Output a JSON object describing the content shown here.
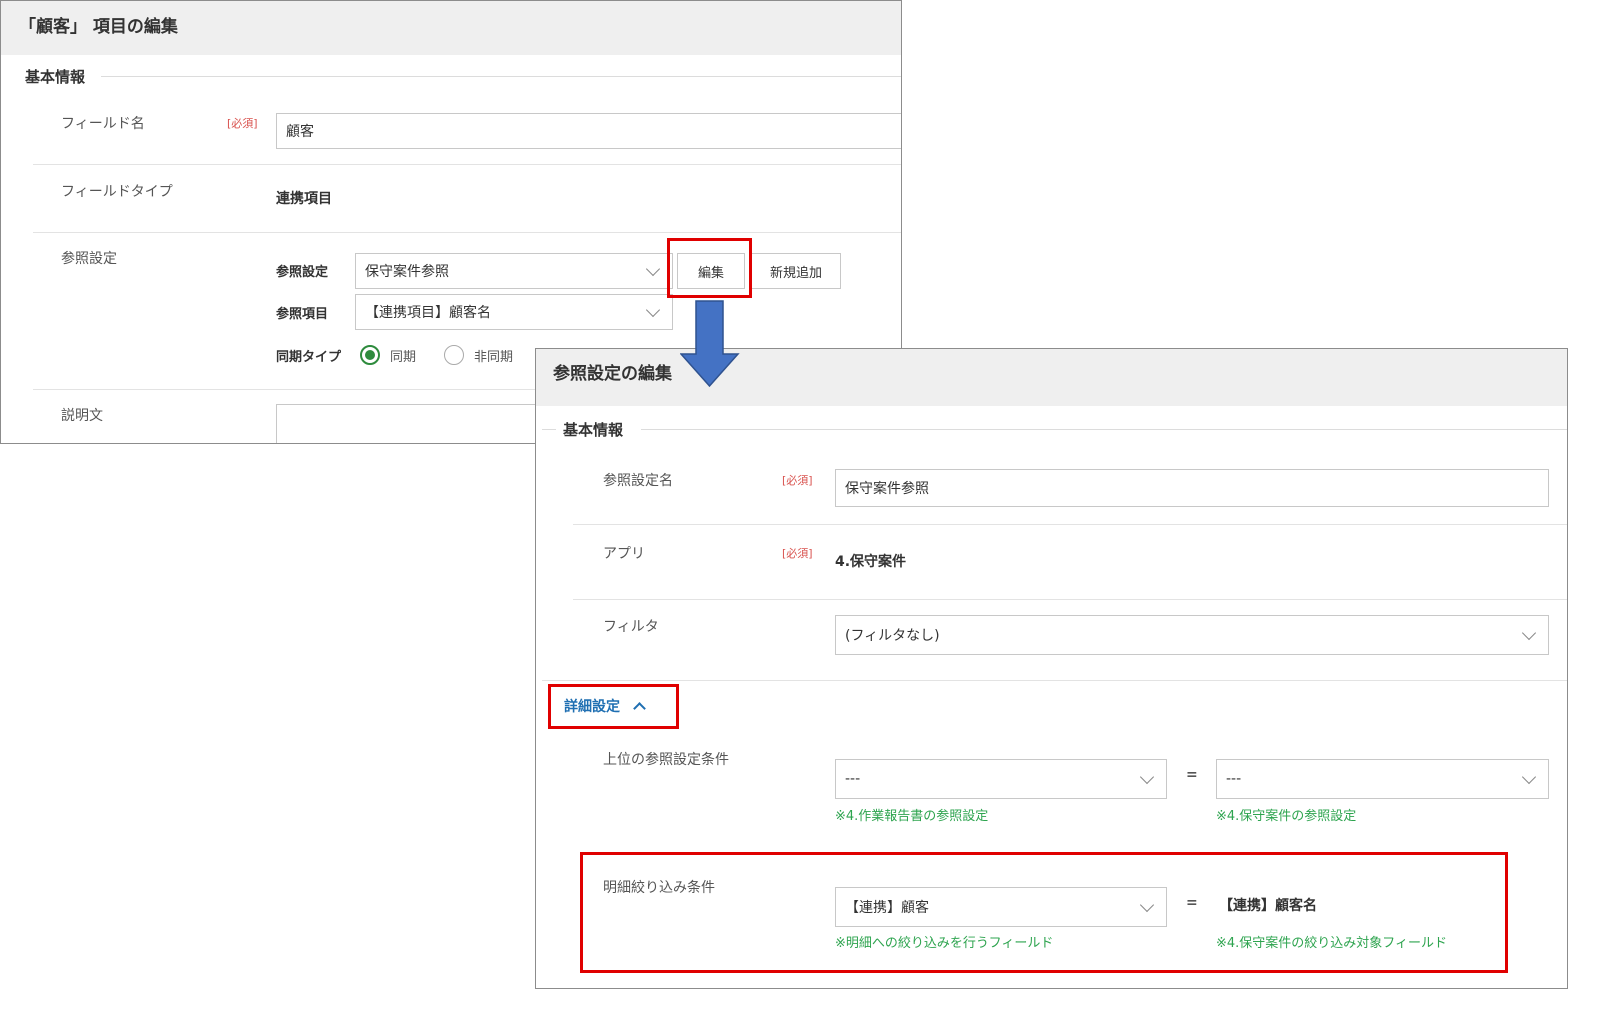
{
  "field_edit": {
    "title": "「顧客」 項目の編集",
    "section_basic": "基本情報",
    "field_name_label": "フィールド名",
    "required_tag": "[必須]",
    "field_name_value": "顧客",
    "field_type_label": "フィールドタイプ",
    "field_type_value": "連携項目",
    "ref_setting_label": "参照設定",
    "ref_setting_sub_label": "参照設定",
    "ref_setting_value": "保守案件参照",
    "edit_button": "編集",
    "add_button": "新規追加",
    "ref_item_label": "参照項目",
    "ref_item_value": "【連携項目】顧客名",
    "sync_type_label": "同期タイプ",
    "sync_on": "同期",
    "sync_off": "非同期",
    "description_label": "説明文"
  },
  "ref_edit": {
    "title": "参照設定の編集",
    "section_basic": "基本情報",
    "name_label": "参照設定名",
    "required_tag": "[必須]",
    "name_value": "保守案件参照",
    "app_label": "アプリ",
    "app_value": "4.保守案件",
    "filter_label": "フィルタ",
    "filter_value": "(フィルタなし)",
    "advanced_label": "詳細設定",
    "upper_cond_label": "上位の参照設定条件",
    "upper_left_value": "---",
    "upper_right_value": "---",
    "equals": "=",
    "upper_left_hint": "※4.作業報告書の参照設定",
    "upper_right_hint": "※4.保守案件の参照設定",
    "detail_cond_label": "明細絞り込み条件",
    "detail_left_value": "【連携】顧客",
    "detail_right_value": "【連携】顧客名",
    "detail_left_hint": "※明細への絞り込みを行うフィールド",
    "detail_right_hint": "※4.保守案件の絞り込み対象フィールド"
  },
  "colors": {
    "highlight": "#e00000",
    "arrow": "#4472c4",
    "hint_green": "#2ea44f",
    "radio_green": "#2e8b3d",
    "link_blue": "#1f6fb2",
    "required_red": "#d9534f"
  },
  "icons": {
    "arrow": "down-arrow-icon",
    "chevron": "chevron-down-icon",
    "collapse": "chevron-up-icon"
  }
}
